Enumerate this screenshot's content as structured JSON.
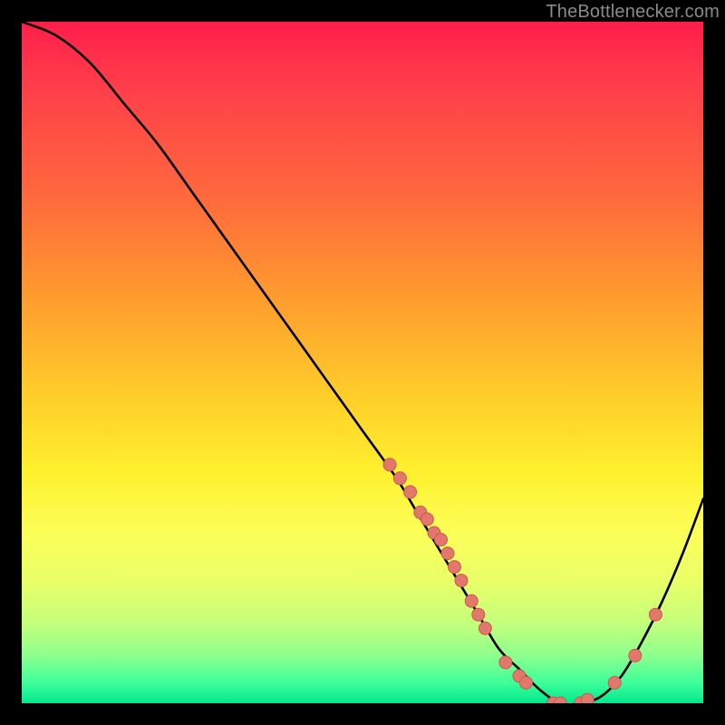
{
  "watermark": "TheBottlenecker.com",
  "colors": {
    "page_bg": "#000000",
    "curve": "#000000",
    "marker": "#e2786c",
    "marker_stroke": "#c95a50"
  },
  "chart_data": {
    "type": "line",
    "title": "",
    "xlabel": "",
    "ylabel": "",
    "xlim": [
      0,
      100
    ],
    "ylim": [
      0,
      100
    ],
    "grid": false,
    "series": [
      {
        "name": "bottleneck_curve",
        "x": [
          0,
          5,
          10,
          15,
          20,
          25,
          30,
          35,
          40,
          45,
          50,
          55,
          58,
          61,
          64,
          67,
          70,
          73,
          76,
          79,
          82,
          85,
          88,
          91,
          94,
          97,
          100
        ],
        "y": [
          100,
          98,
          94,
          88,
          82,
          75,
          68,
          61,
          54,
          47,
          40,
          33,
          28,
          23,
          18,
          13,
          8,
          5,
          2,
          0,
          0,
          1,
          4,
          9,
          15,
          22,
          30
        ]
      }
    ],
    "markers": [
      {
        "x": 54,
        "y": 35
      },
      {
        "x": 55.5,
        "y": 33
      },
      {
        "x": 57,
        "y": 31
      },
      {
        "x": 58.5,
        "y": 28
      },
      {
        "x": 59.5,
        "y": 27
      },
      {
        "x": 60.5,
        "y": 25
      },
      {
        "x": 61.5,
        "y": 24
      },
      {
        "x": 62.5,
        "y": 22
      },
      {
        "x": 63.5,
        "y": 20
      },
      {
        "x": 64.5,
        "y": 18
      },
      {
        "x": 66,
        "y": 15
      },
      {
        "x": 67,
        "y": 13
      },
      {
        "x": 68,
        "y": 11
      },
      {
        "x": 71,
        "y": 6
      },
      {
        "x": 73,
        "y": 4
      },
      {
        "x": 74,
        "y": 3
      },
      {
        "x": 78,
        "y": 0
      },
      {
        "x": 79,
        "y": 0
      },
      {
        "x": 82,
        "y": 0
      },
      {
        "x": 83,
        "y": 0.5
      },
      {
        "x": 87,
        "y": 3
      },
      {
        "x": 90,
        "y": 7
      },
      {
        "x": 93,
        "y": 13
      }
    ]
  }
}
